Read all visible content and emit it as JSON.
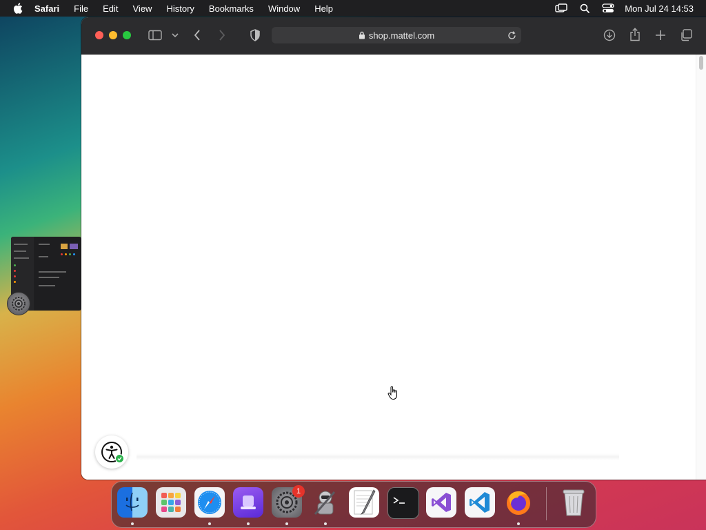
{
  "menubar": {
    "app_name": "Safari",
    "items": [
      "File",
      "Edit",
      "View",
      "History",
      "Bookmarks",
      "Window",
      "Help"
    ],
    "status_icons": [
      "screen-mirroring-icon",
      "spotlight-search-icon",
      "control-center-icon"
    ],
    "clock": "Mon Jul 24  14:53"
  },
  "safari": {
    "url": "shop.mattel.com",
    "toolbar_icons": [
      "sidebar-icon",
      "chevron-down-icon",
      "back-icon",
      "forward-icon",
      "privacy-shield-icon",
      "download-icon",
      "share-icon",
      "new-tab-icon",
      "tab-overview-icon"
    ]
  },
  "dock": {
    "apps": [
      "Finder",
      "Launchpad",
      "Safari",
      "Bezel",
      "System Settings",
      "Automator",
      "TextEdit",
      "Terminal",
      "Visual Studio",
      "Visual Studio Code",
      "Firefox",
      "Trash"
    ],
    "system_settings_badge": "1"
  },
  "colors": {
    "close": "#ff5f57",
    "minimize": "#febc2e",
    "zoom": "#28c840",
    "accessibility_check": "#2bb24c"
  }
}
